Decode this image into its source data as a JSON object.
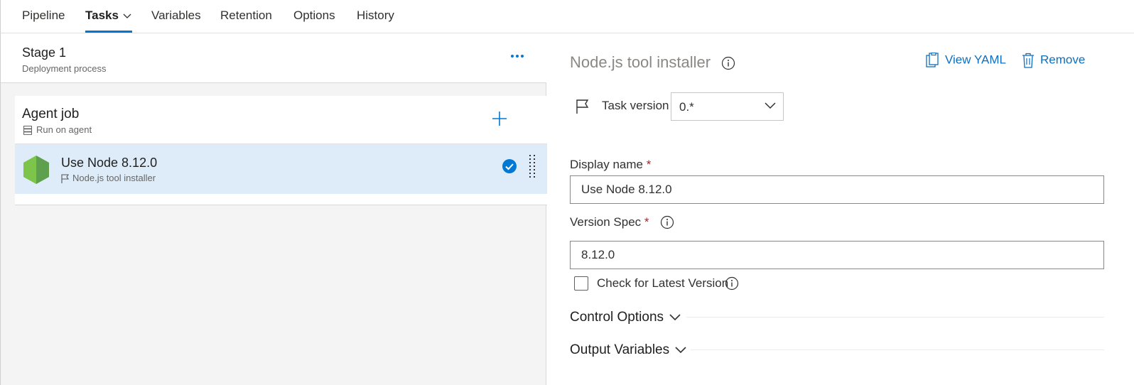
{
  "tabs": [
    {
      "label": "Pipeline"
    },
    {
      "label": "Tasks"
    },
    {
      "label": "Variables"
    },
    {
      "label": "Retention"
    },
    {
      "label": "Options"
    },
    {
      "label": "History"
    }
  ],
  "stage": {
    "title": "Stage 1",
    "subtitle": "Deployment process"
  },
  "agent_job": {
    "title": "Agent job",
    "subtitle": "Run on agent"
  },
  "task": {
    "title": "Use Node 8.12.0",
    "subtitle": "Node.js tool installer"
  },
  "detail": {
    "title": "Node.js tool installer",
    "view_yaml": "View YAML",
    "remove": "Remove",
    "task_version_label": "Task version",
    "task_version_value": "0.*",
    "display_name_label": "Display name",
    "display_name_value": "Use Node 8.12.0",
    "version_spec_label": "Version Spec",
    "version_spec_value": "8.12.0",
    "check_latest_label": "Check for Latest Version",
    "check_latest_checked": false,
    "required_mark": "*",
    "control_options": "Control Options",
    "output_variables": "Output Variables"
  },
  "colors": {
    "accent": "#0078d4",
    "selected_bg": "#deecf9",
    "link": "#106ebe",
    "required": "#a4262c",
    "node_green": "#5fa04e"
  },
  "icons": {
    "more": "more-icon",
    "add": "plus-icon",
    "check": "check-circle-icon",
    "drag": "drag-handle-icon",
    "flag": "flag-icon",
    "server": "server-icon",
    "info": "info-icon",
    "clipboard": "clipboard-icon",
    "trash": "trash-icon",
    "chevron": "chevron-down-icon"
  }
}
